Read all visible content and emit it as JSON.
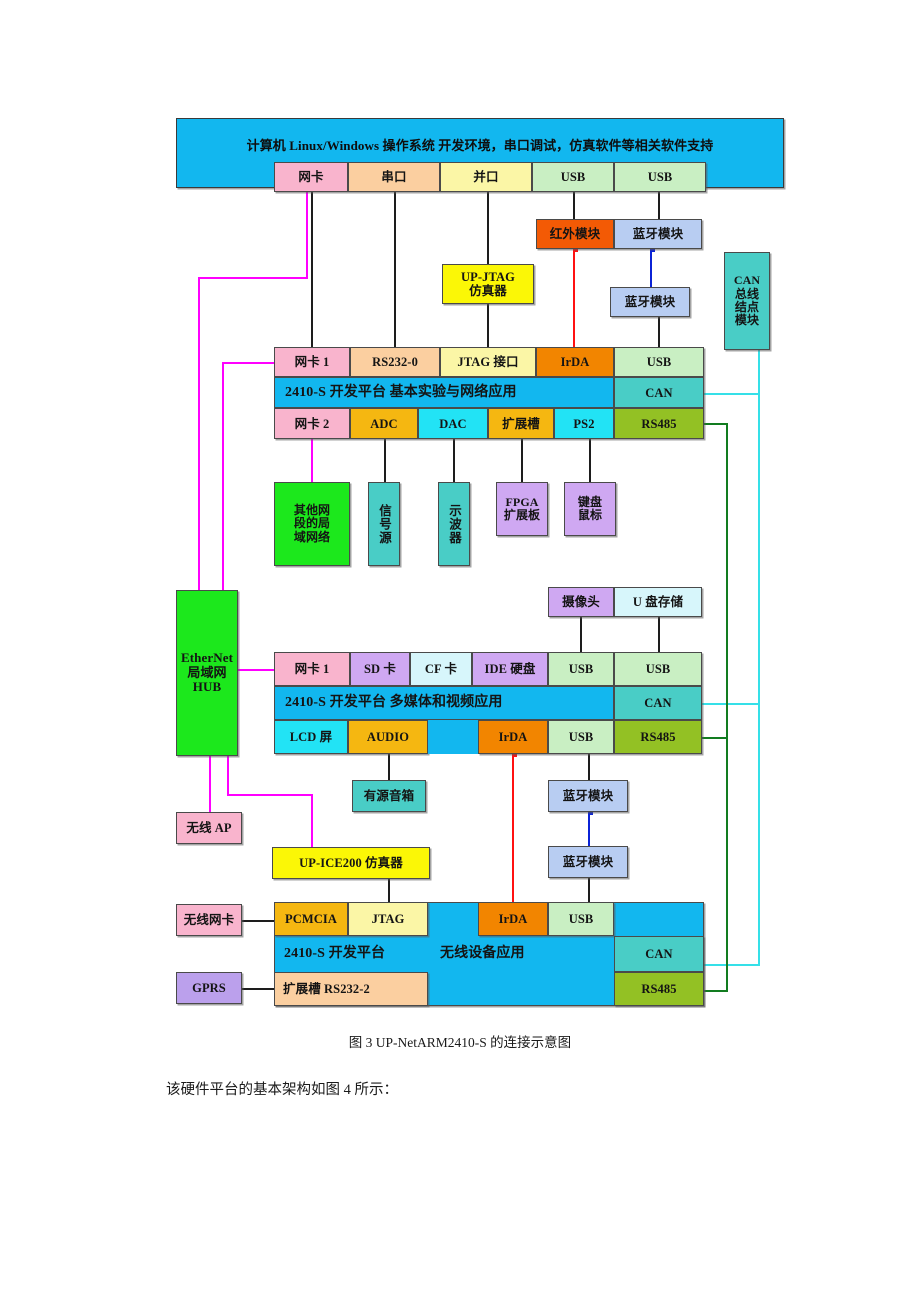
{
  "figure": {
    "caption": "图 3   UP-NetARM2410-S 的连接示意图",
    "following_text": "该硬件平台的基本架构如图 4 所示："
  },
  "colors": {
    "platform_blue": "#12b7ef",
    "pink": "#f9b4cd",
    "peach": "#fbcfa0",
    "pale_yellow": "#fbf6a6",
    "pale_green": "#c9efc3",
    "orange": "#f28500",
    "amber": "#f5b711",
    "cyan": "#22e3f5",
    "olive": "#93c124",
    "teal": "#49cdc6",
    "violet": "#cfa8f2",
    "lavender": "#b8cdf2",
    "ice": "#d7f6fb",
    "green": "#1ce81c",
    "yellow": "#fbf706",
    "red_orange": "#f35a05",
    "purple": "#bba0ec",
    "line_black": "#1d1d1d",
    "line_magenta": "#ff00ff",
    "line_cyan": "#35e0e8",
    "line_green": "#127c20",
    "line_red": "#ff1111",
    "line_blue": "#0b23d6"
  },
  "host": {
    "title": "计算机  Linux/Windows 操作系统    开发环境，串口调试，仿真软件等相关软件支持",
    "ports": [
      {
        "label": "网卡",
        "color": "#f9b4cd"
      },
      {
        "label": "串口",
        "color": "#fbcfa0"
      },
      {
        "label": "并口",
        "color": "#fbf6a6"
      },
      {
        "label": "USB",
        "color": "#c9efc3"
      },
      {
        "label": "USB",
        "color": "#c9efc3"
      }
    ]
  },
  "top_modules": {
    "ir_module": {
      "label": "红外模块",
      "color": "#f35a05"
    },
    "bt_module_1": {
      "label": "蓝牙模块",
      "color": "#b8cdf2"
    },
    "bt_module_2": {
      "label": "蓝牙模块",
      "color": "#b8cdf2"
    },
    "up_jtag": {
      "label": "UP-JTAG\n仿真器",
      "color": "#fbf706"
    },
    "can_node": {
      "label": "CAN\n总线\n结点\n模块",
      "color": "#49cdc6"
    }
  },
  "platform_1": {
    "title": "2410-S 开发平台  基本实验与网络应用",
    "can_label": "CAN",
    "top_ports": [
      {
        "label": "网卡 1",
        "color": "#f9b4cd"
      },
      {
        "label": "RS232-0",
        "color": "#fbcfa0"
      },
      {
        "label": "JTAG 接口",
        "color": "#fbf6a6"
      },
      {
        "label": "IrDA",
        "color": "#f28500"
      },
      {
        "label": "USB",
        "color": "#c9efc3"
      }
    ],
    "bottom_ports": [
      {
        "label": "网卡 2",
        "color": "#f9b4cd"
      },
      {
        "label": "ADC",
        "color": "#f5b711"
      },
      {
        "label": "DAC",
        "color": "#22e3f5"
      },
      {
        "label": "扩展槽",
        "color": "#f5b711"
      },
      {
        "label": "PS2",
        "color": "#22e3f5"
      },
      {
        "label": "RS485",
        "color": "#93c124"
      }
    ],
    "peripherals": [
      {
        "label": "其他网\n段的局\n域网络",
        "color": "#1ce81c"
      },
      {
        "label": "信号源",
        "color": "#49cdc6"
      },
      {
        "label": "示波器",
        "color": "#49cdc6"
      },
      {
        "label": "FPGA\n扩展板",
        "color": "#cfa8f2"
      },
      {
        "label": "键盘\n鼠标",
        "color": "#cfa8f2"
      }
    ]
  },
  "hub": {
    "label": "EtherNet\n局域网\nHUB",
    "color": "#1ce81c"
  },
  "platform_2": {
    "title": "2410-S 开发平台  多媒体和视频应用",
    "can_label": "CAN",
    "top_ports": [
      {
        "label": "网卡 1",
        "color": "#f9b4cd"
      },
      {
        "label": "SD 卡",
        "color": "#cfa8f2"
      },
      {
        "label": "CF 卡",
        "color": "#d7f6fb"
      },
      {
        "label": "IDE 硬盘",
        "color": "#cfa8f2"
      },
      {
        "label": "USB",
        "color": "#c9efc3"
      },
      {
        "label": "USB",
        "color": "#c9efc3"
      }
    ],
    "bottom_ports": [
      {
        "label": "LCD 屏",
        "color": "#22e3f5"
      },
      {
        "label": "AUDIO",
        "color": "#f5b711"
      },
      {
        "label": "IrDA",
        "color": "#f28500"
      },
      {
        "label": "USB",
        "color": "#c9efc3"
      },
      {
        "label": "RS485",
        "color": "#93c124"
      }
    ],
    "above": [
      {
        "label": "摄像头",
        "color": "#cfa8f2"
      },
      {
        "label": "U 盘存储",
        "color": "#d7f6fb"
      }
    ],
    "below": [
      {
        "label": "有源音箱",
        "color": "#49cdc6"
      },
      {
        "label": "蓝牙模块",
        "color": "#b8cdf2"
      },
      {
        "label": "蓝牙模块",
        "color": "#b8cdf2"
      }
    ]
  },
  "platform_3": {
    "title_left": "2410-S 开发平台",
    "title_right": "无线设备应用",
    "can_label": "CAN",
    "rs485_label": "RS485",
    "top_ports": [
      {
        "label": "PCMCIA",
        "color": "#f5b711"
      },
      {
        "label": "JTAG",
        "color": "#fbf6a6"
      },
      {
        "label": "IrDA",
        "color": "#f28500"
      },
      {
        "label": "USB",
        "color": "#c9efc3"
      }
    ],
    "bottom_ports": [
      {
        "label": "扩展槽 RS232-2",
        "color": "#fbcfa0"
      }
    ],
    "left_devices": [
      {
        "label": "无线网卡",
        "color": "#f9b4cd"
      },
      {
        "label": "GPRS",
        "color": "#bba0ec"
      }
    ],
    "wireless_ap": {
      "label": "无线 AP",
      "color": "#f9b4cd"
    },
    "up_ice200": {
      "label": "UP-ICE200 仿真器",
      "color": "#fbf706"
    }
  }
}
